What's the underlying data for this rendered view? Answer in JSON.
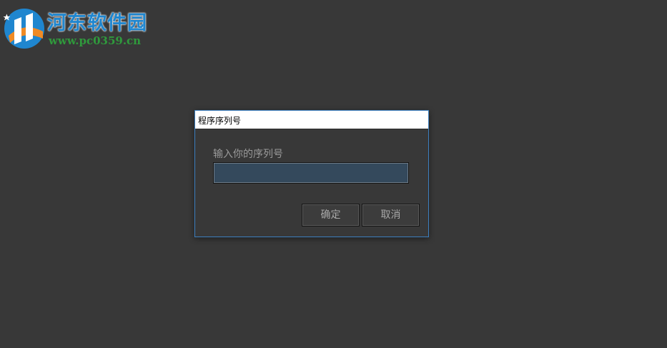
{
  "watermark": {
    "title": "河东软件园",
    "url": "www.pc0359.cn"
  },
  "dialog": {
    "title": "程序序列号",
    "prompt": "输入你的序列号",
    "serial_input": {
      "value": "",
      "placeholder": ""
    },
    "ok_label": "确定",
    "cancel_label": "取消"
  },
  "colors": {
    "background": "#383838",
    "dialog_border": "#3c7fbf",
    "input_background": "#34495c",
    "button_background": "#3c3c3c",
    "button_text": "#a8a8a8",
    "logo_blue": "#1f86cf",
    "logo_green": "#2f9a3c",
    "logo_orange": "#f08a24"
  }
}
